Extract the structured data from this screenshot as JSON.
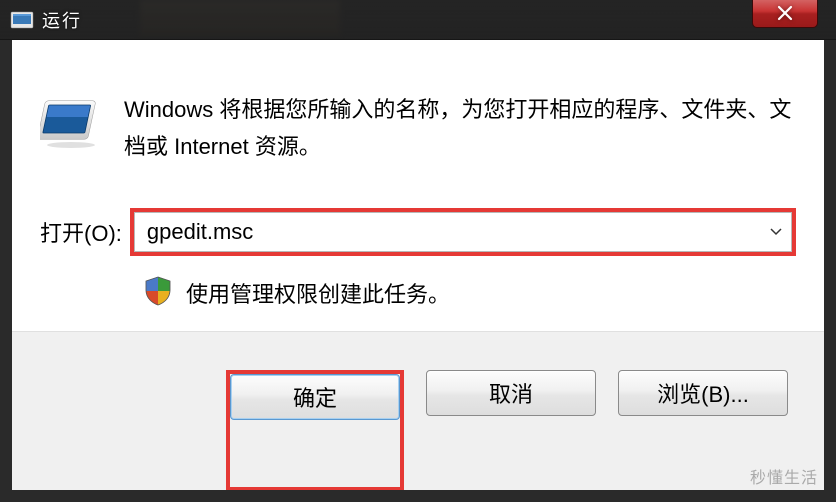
{
  "titlebar": {
    "title": "运行"
  },
  "content": {
    "description": "Windows 将根据您所输入的名称，为您打开相应的程序、文件夹、文档或 Internet 资源。",
    "open_label": "打开(O):",
    "input_value": "gpedit.msc",
    "shield_note": "使用管理权限创建此任务。"
  },
  "buttons": {
    "ok": "确定",
    "cancel": "取消",
    "browse": "浏览(B)..."
  },
  "watermark": {
    "main": "秒懂生活"
  }
}
